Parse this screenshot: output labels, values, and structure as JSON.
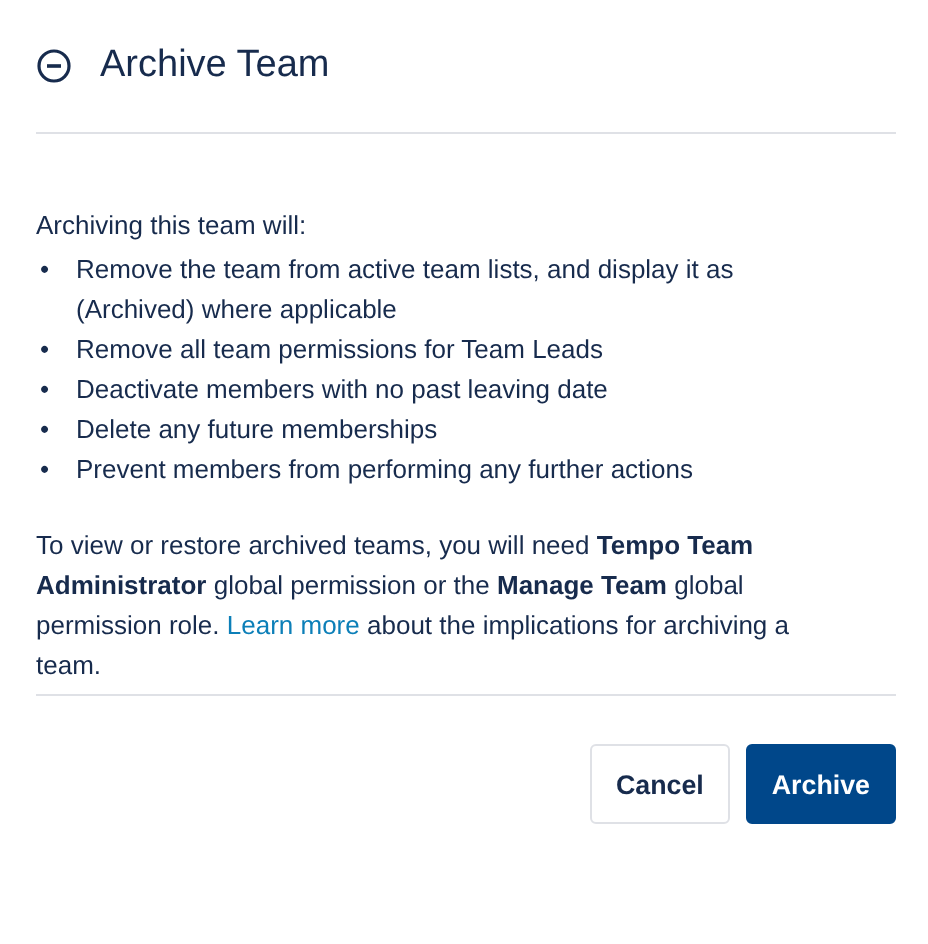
{
  "dialog": {
    "title": "Archive Team",
    "intro": "Archiving this team will:",
    "consequences": [
      {
        "marker": "•",
        "text": "Remove the team from active team lists, and display it as (Archived) where applicable"
      },
      {
        "marker": "•",
        "text": "Remove all team permissions for Team Leads"
      },
      {
        "marker": "•",
        "text": "Deactivate members with no past leaving date"
      },
      {
        "marker": "•",
        "text": "Delete any future memberships"
      },
      {
        "marker": "•",
        "text": "Prevent members from performing any further actions"
      }
    ],
    "note": {
      "before": "To view or restore archived teams, you will need **Tempo Team Administrator** global permission or the **Manage Team** global permission role.",
      "link": "Learn more",
      "after": "about the implications for archiving a team."
    },
    "buttons": [
      {
        "label": "Cancel",
        "kind": "secondary"
      },
      {
        "label": "Archive",
        "kind": "primary"
      }
    ]
  }
}
